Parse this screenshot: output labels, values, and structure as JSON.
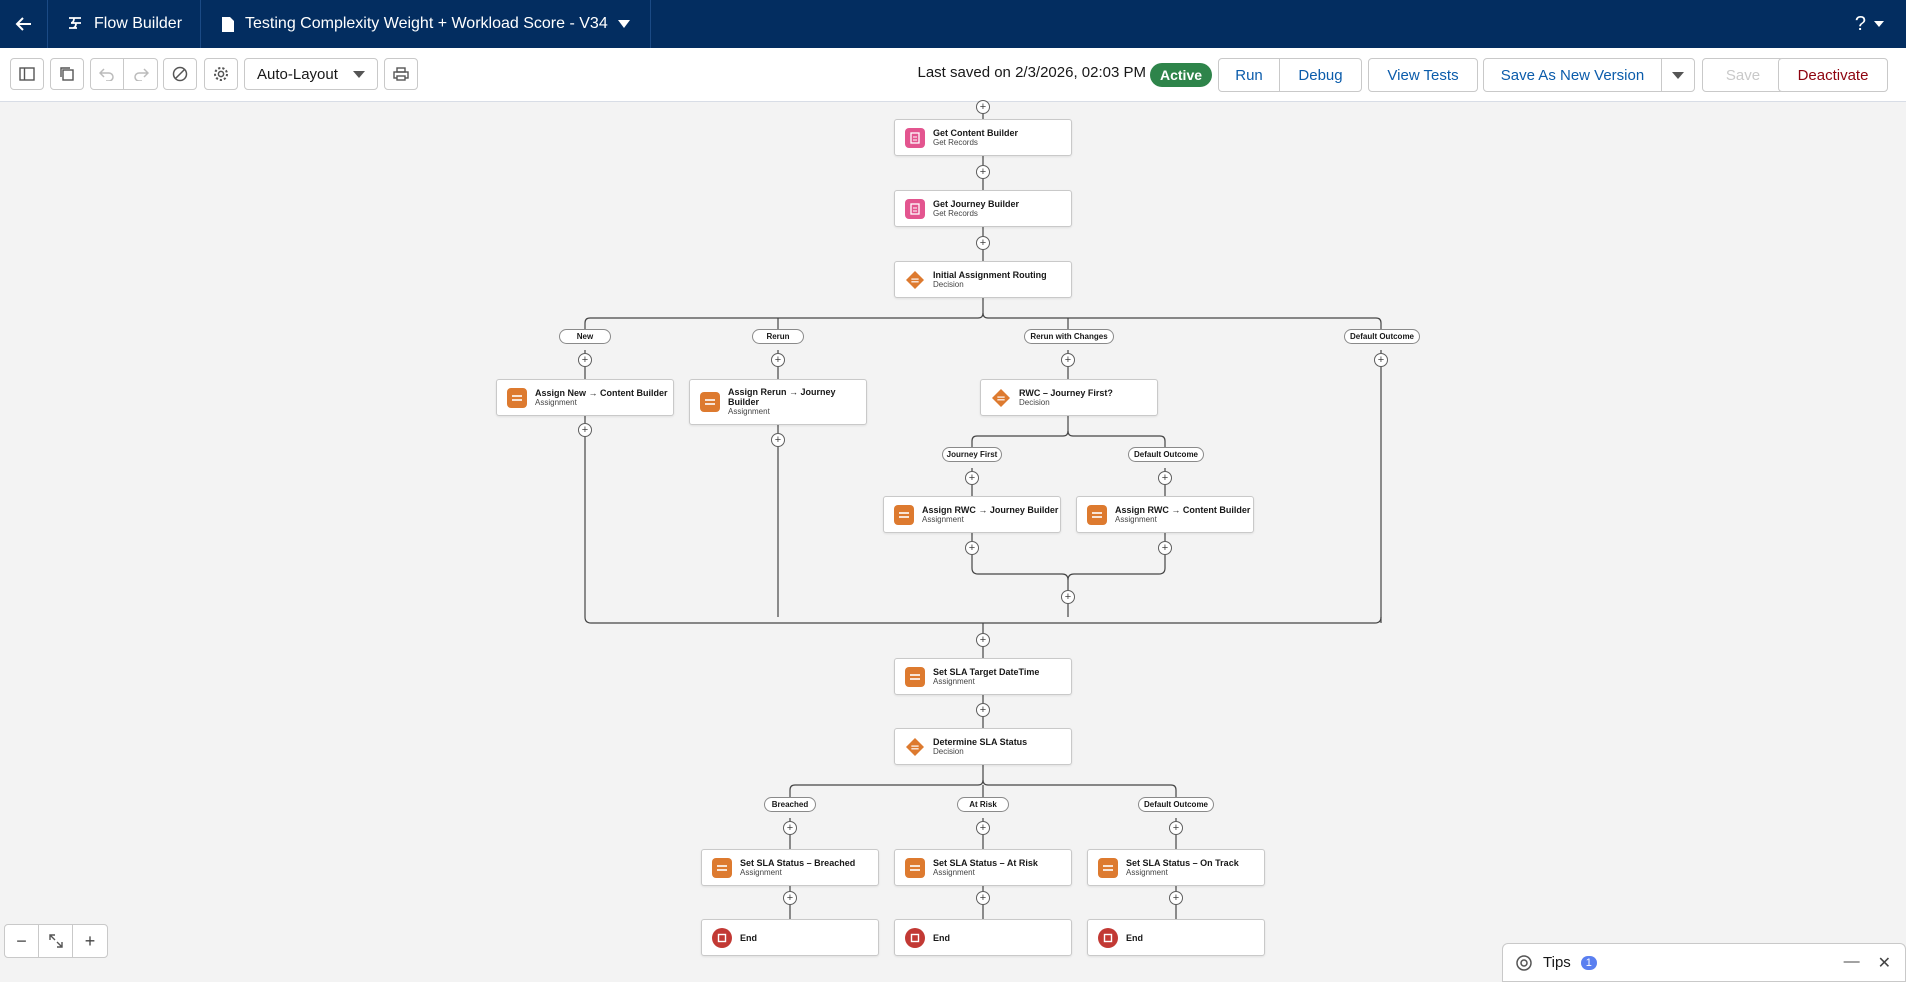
{
  "header": {
    "app_name": "Flow Builder",
    "flow_title": "Testing Complexity Weight + Workload Score - V34",
    "help_label": "?"
  },
  "toolbar": {
    "layout_mode": "Auto-Layout",
    "last_saved": "Last saved on 2/3/2026, 02:03 PM",
    "status": "Active",
    "run": "Run",
    "debug": "Debug",
    "view_tests": "View Tests",
    "save_as_new": "Save As New Version",
    "save": "Save",
    "deactivate": "Deactivate"
  },
  "nodes": {
    "get_content": {
      "title": "Get Content Builder",
      "type": "Get Records"
    },
    "get_journey": {
      "title": "Get Journey Builder",
      "type": "Get Records"
    },
    "initial_routing": {
      "title": "Initial Assignment Routing",
      "type": "Decision"
    },
    "assign_new": {
      "title": "Assign New → Content Builder",
      "type": "Assignment"
    },
    "assign_rerun": {
      "title": "Assign Rerun → Journey Builder",
      "type": "Assignment"
    },
    "rwc_decision": {
      "title": "RWC – Journey First?",
      "type": "Decision"
    },
    "assign_rwc_journey": {
      "title": "Assign RWC → Journey Builder",
      "type": "Assignment"
    },
    "assign_rwc_content": {
      "title": "Assign RWC → Content Builder",
      "type": "Assignment"
    },
    "set_sla_target": {
      "title": "Set SLA Target DateTime",
      "type": "Assignment"
    },
    "determine_sla": {
      "title": "Determine SLA Status",
      "type": "Decision"
    },
    "sla_breached": {
      "title": "Set SLA Status – Breached",
      "type": "Assignment"
    },
    "sla_atrisk": {
      "title": "Set SLA Status – At Risk",
      "type": "Assignment"
    },
    "sla_ontrack": {
      "title": "Set SLA Status – On Track",
      "type": "Assignment"
    },
    "end": {
      "title": "End"
    }
  },
  "branches": {
    "new": "New",
    "rerun": "Rerun",
    "rerun_changes": "Rerun with Changes",
    "default_outcome": "Default Outcome",
    "journey_first": "Journey First",
    "breached": "Breached",
    "at_risk": "At Risk"
  },
  "tips": {
    "label": "Tips",
    "count": "1"
  },
  "colors": {
    "header_bg": "#032d60",
    "active_badge": "#2e844a",
    "get_records_icon": "#e3558f",
    "assignment_icon": "#dd7a2f",
    "end_icon": "#c23934",
    "link": "#0b5cab"
  }
}
